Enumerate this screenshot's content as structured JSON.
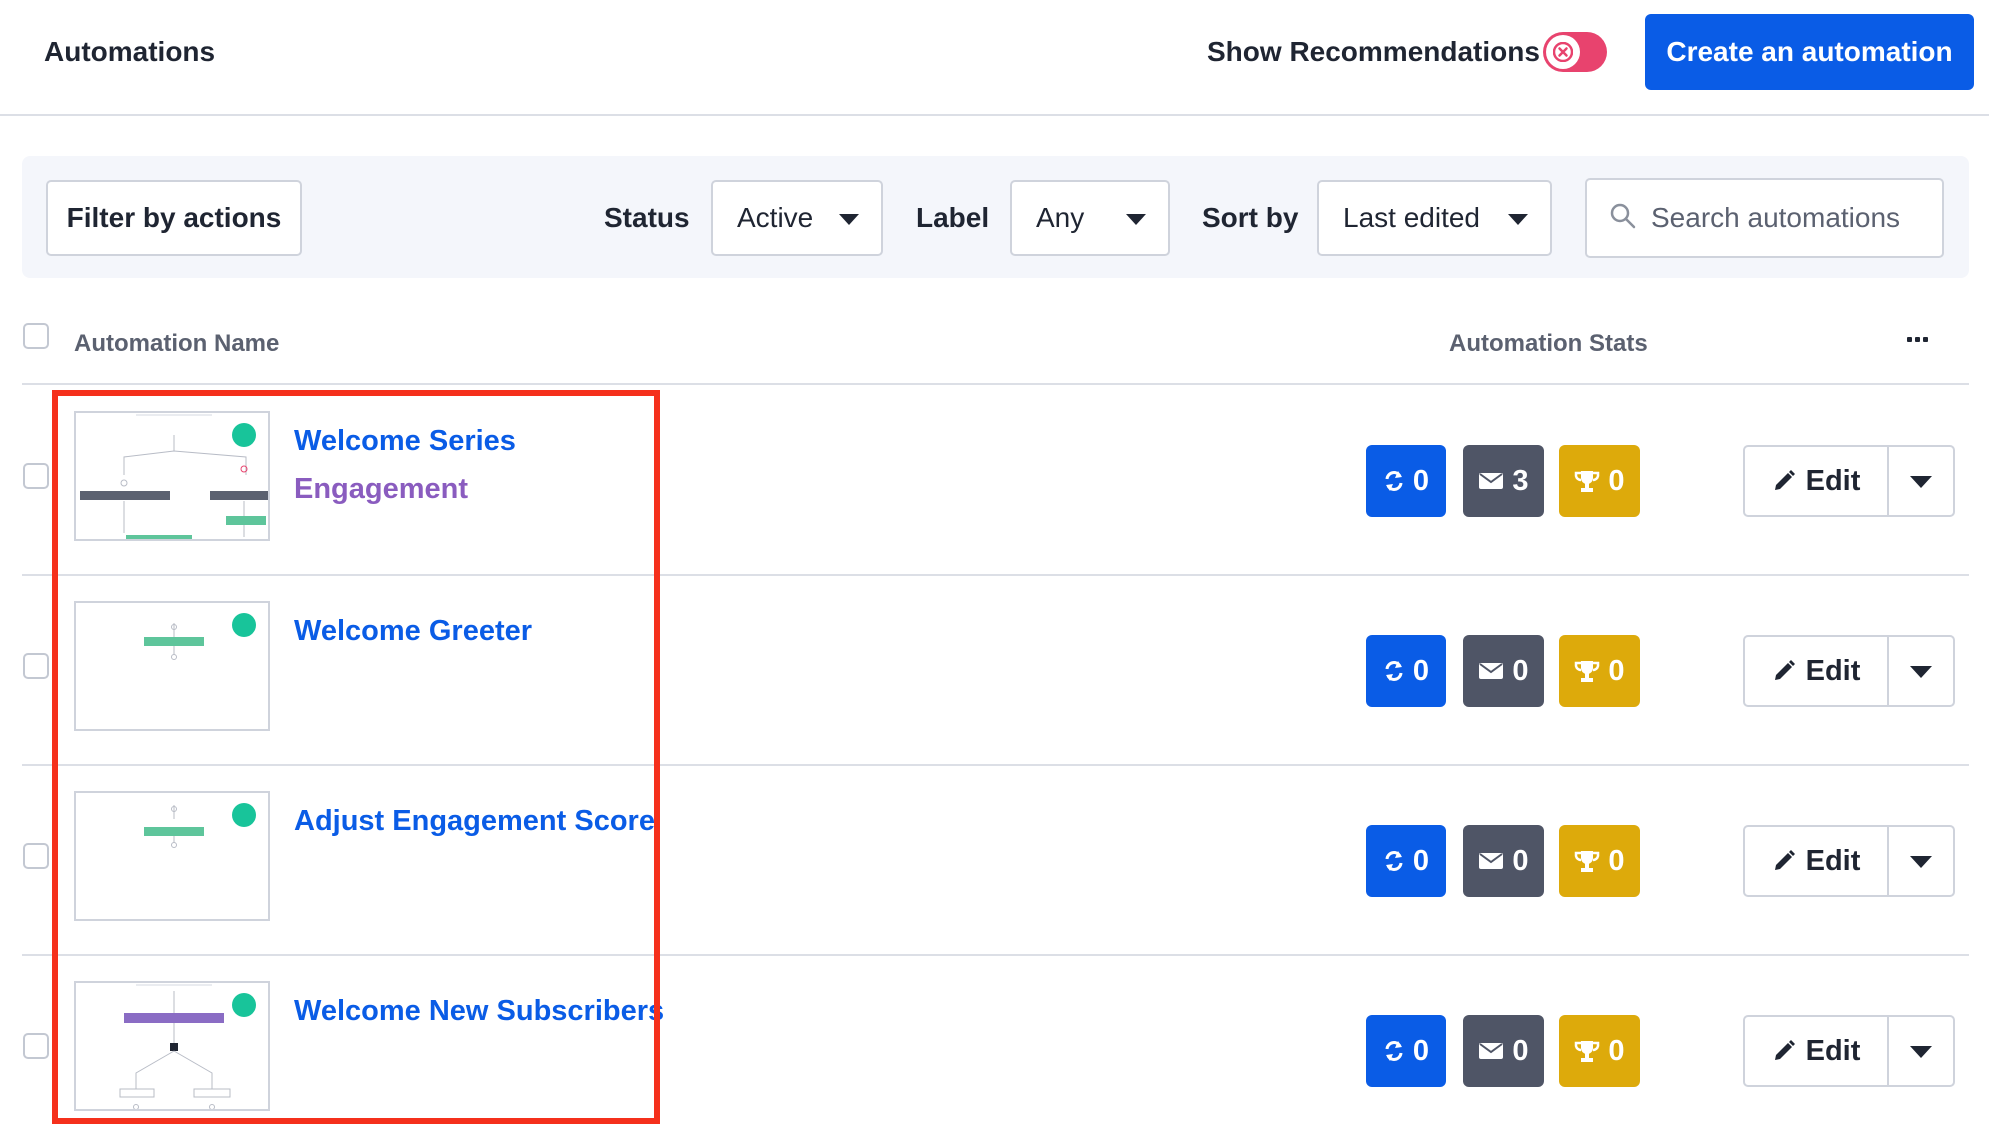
{
  "header": {
    "title": "Automations",
    "show_recommendations_label": "Show Recommendations",
    "create_button_label": "Create an automation"
  },
  "filters": {
    "filter_by_actions_label": "Filter by actions",
    "status_label": "Status",
    "status_value": "Active",
    "label_label": "Label",
    "label_value": "Any",
    "sort_label": "Sort by",
    "sort_value": "Last edited",
    "search_placeholder": "Search automations"
  },
  "table": {
    "col_name": "Automation Name",
    "col_stats": "Automation Stats",
    "edit_label": "Edit",
    "rows": [
      {
        "name": "Welcome Series",
        "label": "Engagement",
        "contacts": "0",
        "emails": "3",
        "goals": "0"
      },
      {
        "name": "Welcome Greeter",
        "label": "",
        "contacts": "0",
        "emails": "0",
        "goals": "0"
      },
      {
        "name": "Adjust Engagement Score",
        "label": "",
        "contacts": "0",
        "emails": "0",
        "goals": "0"
      },
      {
        "name": "Welcome New Subscribers",
        "label": "",
        "contacts": "0",
        "emails": "0",
        "goals": "0"
      }
    ]
  },
  "icons": {
    "toggle": "close-icon",
    "search": "search-icon",
    "contacts": "refresh-icon",
    "emails": "envelope-icon",
    "goals": "trophy-icon",
    "edit": "pencil-icon",
    "more": "more-horizontal-icon"
  },
  "colors": {
    "primary": "#0a5ce6",
    "toggle_off": "#e8436e",
    "stat_gray": "#4f5566",
    "stat_gold": "#ddaa0b",
    "label_purple": "#8a5cbf",
    "status_dot": "#18c49a",
    "highlight": "#f5301c"
  }
}
